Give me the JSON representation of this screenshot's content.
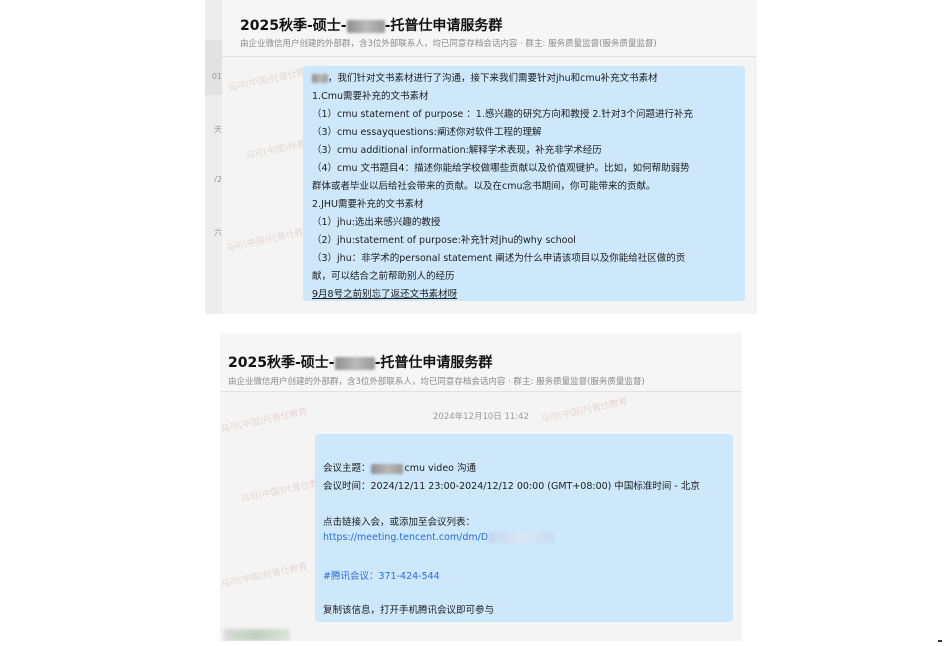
{
  "top": {
    "title_prefix": "2025秋季-硕士-",
    "title_suffix": "-托普仕申请服务群",
    "subtitle": "由企业微信用户创建的外部群，含3位外部联系人，均已同意存档会话内容 · 群主: 服务质量监督(服务质量监督)",
    "sidebar_items": [
      "01",
      "天",
      "/2",
      "六"
    ],
    "watermark": "马可(中国)托普仕教育",
    "message_lines": [
      "，我们针对文书素材进行了沟通，接下来我们需要针对jhu和cmu补充文书素材",
      "1.Cmu需要补充的文书素材",
      "（1）cmu statement of purpose ：1.感兴趣的研究方向和教授 2.针对3个问题进行补充",
      "（3）cmu essayquestions:阐述你对软件工程的理解",
      "（3）cmu additional information:解释学术表现，补充非学术经历",
      "（4）cmu 文书题目4：描述你能给学校做哪些贡献以及价值观键护。比如，如何帮助弱势",
      "群体或者毕业以后给社会带来的贡献。以及在cmu念书期间，你可能带来的贡献。",
      "2.JHU需要补充的文书素材",
      "（1）jhu:选出来感兴趣的教授",
      "（2）jhu:statement of purpose:补充针对jhu的why school",
      "（3）jhu：非学术的personal statement 阐述为什么申请该项目以及你能给社区做的贡",
      "献，可以结合之前帮助别人的经历"
    ],
    "last_line": "9月8号之前别忘了返还文书素材呀"
  },
  "bottom": {
    "title_prefix": "2025秋季-硕士-",
    "title_suffix": "-托普仕申请服务群",
    "subtitle": "由企业微信用户创建的外部群，含3位外部联系人，均已同意存档会话内容 · 群主: 服务质量监督(服务质量监督)",
    "timestamp": "2024年12月10日 11:42",
    "watermark": "马可(中国)托普仕教育",
    "meeting_topic_label": "会议主题：",
    "meeting_topic": "cmu video 沟通",
    "meeting_time": "会议时间：2024/12/11 23:00-2024/12/12 00:00 (GMT+08:00) 中国标准时间 - 北京",
    "join_hint": "点击链接入会，或添加至会议列表：",
    "link": "https://meeting.tencent.com/dm/D",
    "meeting_id": "#腾讯会议：371-424-544",
    "footer": "复制该信息，打开手机腾讯会议即可参与"
  },
  "colors": {
    "bubble": "#cde7fb",
    "panel": "#f4f4f4",
    "link": "#2a6fd6"
  }
}
